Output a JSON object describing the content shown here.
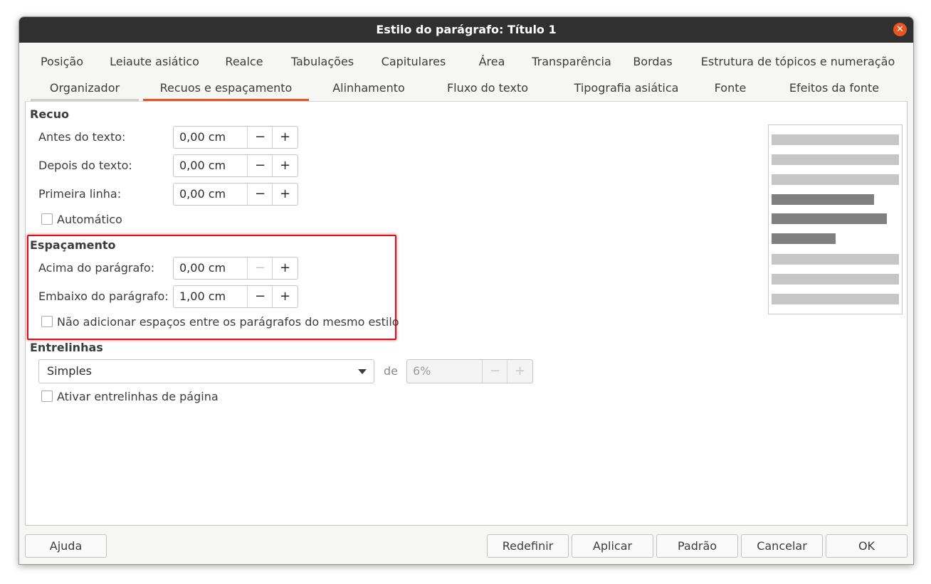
{
  "window": {
    "title": "Estilo do parágrafo: Título 1"
  },
  "tabs_row1": [
    "Posição",
    "Leiaute asiático",
    "Realce",
    "Tabulações",
    "Capitulares",
    "Área",
    "Transparência",
    "Bordas",
    "Estrutura de tópicos e numeração"
  ],
  "tabs_row2": [
    "Organizador",
    "Recuos e espaçamento",
    "Alinhamento",
    "Fluxo do texto",
    "Tipografia asiática",
    "Fonte",
    "Efeitos da fonte"
  ],
  "active_tab": "Recuos e espaçamento",
  "recuo": {
    "heading": "Recuo",
    "antes_label": "Antes do texto:",
    "antes_value": "0,00 cm",
    "depois_label": "Depois do texto:",
    "depois_value": "0,00 cm",
    "primeira_label": "Primeira linha:",
    "primeira_value": "0,00 cm",
    "automatico_label": "Automático"
  },
  "espacamento": {
    "heading": "Espaçamento",
    "acima_label": "Acima do parágrafo:",
    "acima_value": "0,00 cm",
    "embaixo_label": "Embaixo do parágrafo:",
    "embaixo_value": "1,00 cm",
    "nao_adicionar_label": "Não adicionar espaços entre os parágrafos do mesmo estilo"
  },
  "entrelinhas": {
    "heading": "Entrelinhas",
    "mode_value": "Simples",
    "de_label": "de",
    "percent_value": "6%",
    "ativar_label": "Ativar entrelinhas de página"
  },
  "spin_symbols": {
    "minus": "−",
    "plus": "+"
  },
  "buttons": {
    "help": "Ajuda",
    "reset": "Redefinir",
    "apply": "Aplicar",
    "default": "Padrão",
    "cancel": "Cancelar",
    "ok": "OK"
  },
  "colors": {
    "accent": "#e95420",
    "titlebar": "#303030",
    "highlight": "#d9101a",
    "preview_light": "#c6c6c6",
    "preview_dark": "#808080"
  },
  "icons": {
    "close": "close-icon",
    "dropdown": "chevron-down-icon"
  }
}
